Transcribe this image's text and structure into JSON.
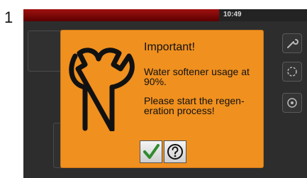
{
  "step_number": "1",
  "status_bar": {
    "time": "10:49"
  },
  "dialog": {
    "title": "Important!",
    "message_1": "Water softener usage at 90%.",
    "message_2": "Please start the regen-eration process!",
    "icon": "wrench-icon",
    "buttons": [
      {
        "name": "confirm-button",
        "icon": "check-icon",
        "color": "#2e8b2e"
      },
      {
        "name": "help-button",
        "icon": "question-icon"
      }
    ]
  },
  "side_buttons": [
    "wrench-icon",
    "cycle-icon",
    "settings-icon"
  ],
  "colors": {
    "dialog_bg": "#f0901f",
    "status_red": "#a01010",
    "screen_bg": "#2d2d2d"
  }
}
